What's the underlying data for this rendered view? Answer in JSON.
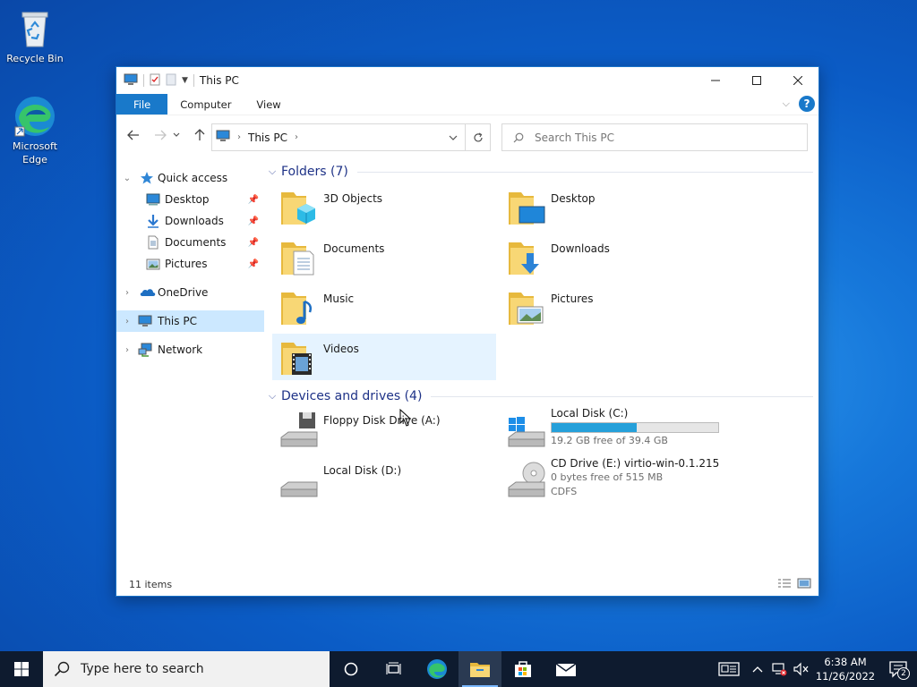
{
  "desktop": {
    "icons": [
      {
        "label": "Recycle Bin",
        "icon": "recycle-bin-icon"
      },
      {
        "label": "Microsoft Edge",
        "icon": "edge-icon"
      }
    ]
  },
  "window": {
    "title": "This PC",
    "ribbon_tabs": [
      "File",
      "Computer",
      "View"
    ],
    "address": {
      "breadcrumb": "This PC"
    },
    "search": {
      "placeholder": "Search This PC"
    },
    "controls": {
      "minimize": "minimize-icon",
      "maximize": "maximize-icon",
      "close": "close-icon"
    }
  },
  "navpane": {
    "quick_access": {
      "label": "Quick access"
    },
    "quick_items": [
      {
        "label": "Desktop",
        "icon": "desktop-icon"
      },
      {
        "label": "Downloads",
        "icon": "download-arrow-icon"
      },
      {
        "label": "Documents",
        "icon": "document-icon"
      },
      {
        "label": "Pictures",
        "icon": "pictures-icon"
      }
    ],
    "onedrive": {
      "label": "OneDrive"
    },
    "thispc": {
      "label": "This PC"
    },
    "network": {
      "label": "Network"
    }
  },
  "folders": {
    "header": "Folders (7)",
    "items": [
      {
        "name": "3D Objects",
        "icon": "3d-objects-folder-icon"
      },
      {
        "name": "Desktop",
        "icon": "desktop-folder-icon"
      },
      {
        "name": "Documents",
        "icon": "documents-folder-icon"
      },
      {
        "name": "Downloads",
        "icon": "downloads-folder-icon"
      },
      {
        "name": "Music",
        "icon": "music-folder-icon"
      },
      {
        "name": "Pictures",
        "icon": "pictures-folder-icon"
      },
      {
        "name": "Videos",
        "icon": "videos-folder-icon"
      }
    ]
  },
  "drives": {
    "header": "Devices and drives (4)",
    "items": [
      {
        "name": "Floppy Disk Drive (A:)",
        "icon": "floppy-drive-icon"
      },
      {
        "name": "Local Disk (C:)",
        "free": "19.2 GB free of 39.4 GB",
        "used_fraction": 0.51,
        "icon": "windows-drive-icon"
      },
      {
        "name": "Local Disk (D:)",
        "icon": "hard-drive-icon"
      },
      {
        "name": "CD Drive (E:) virtio-win-0.1.215",
        "free": "0 bytes free of 515 MB",
        "fs": "CDFS",
        "icon": "cd-drive-icon"
      }
    ]
  },
  "status": {
    "items": "11 items"
  },
  "taskbar": {
    "search_placeholder": "Type here to search",
    "time": "6:38 AM",
    "date": "11/26/2022",
    "notification_count": "2"
  },
  "colors": {
    "accent": "#1979ca",
    "selection": "#cce8ff",
    "hover": "#e5f3ff",
    "bar_fill": "#26a0da"
  }
}
